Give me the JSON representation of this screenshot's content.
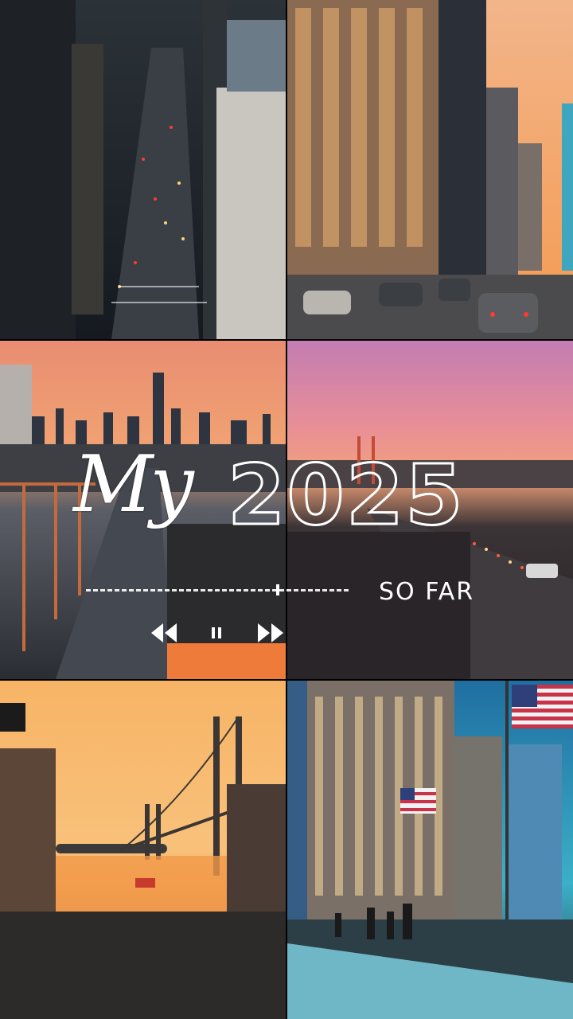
{
  "title": {
    "script": "My",
    "year": "2025",
    "subtitle": "SO FAR"
  },
  "player": {
    "progress": 0.73,
    "controls": [
      "rewind-icon",
      "pause-icon",
      "fast-forward-icon"
    ]
  },
  "colors": {
    "title": "#ffffff",
    "sunset_orange": "#f39a4a",
    "sunset_pink": "#e98a8a",
    "night_blue": "#1c2430"
  }
}
